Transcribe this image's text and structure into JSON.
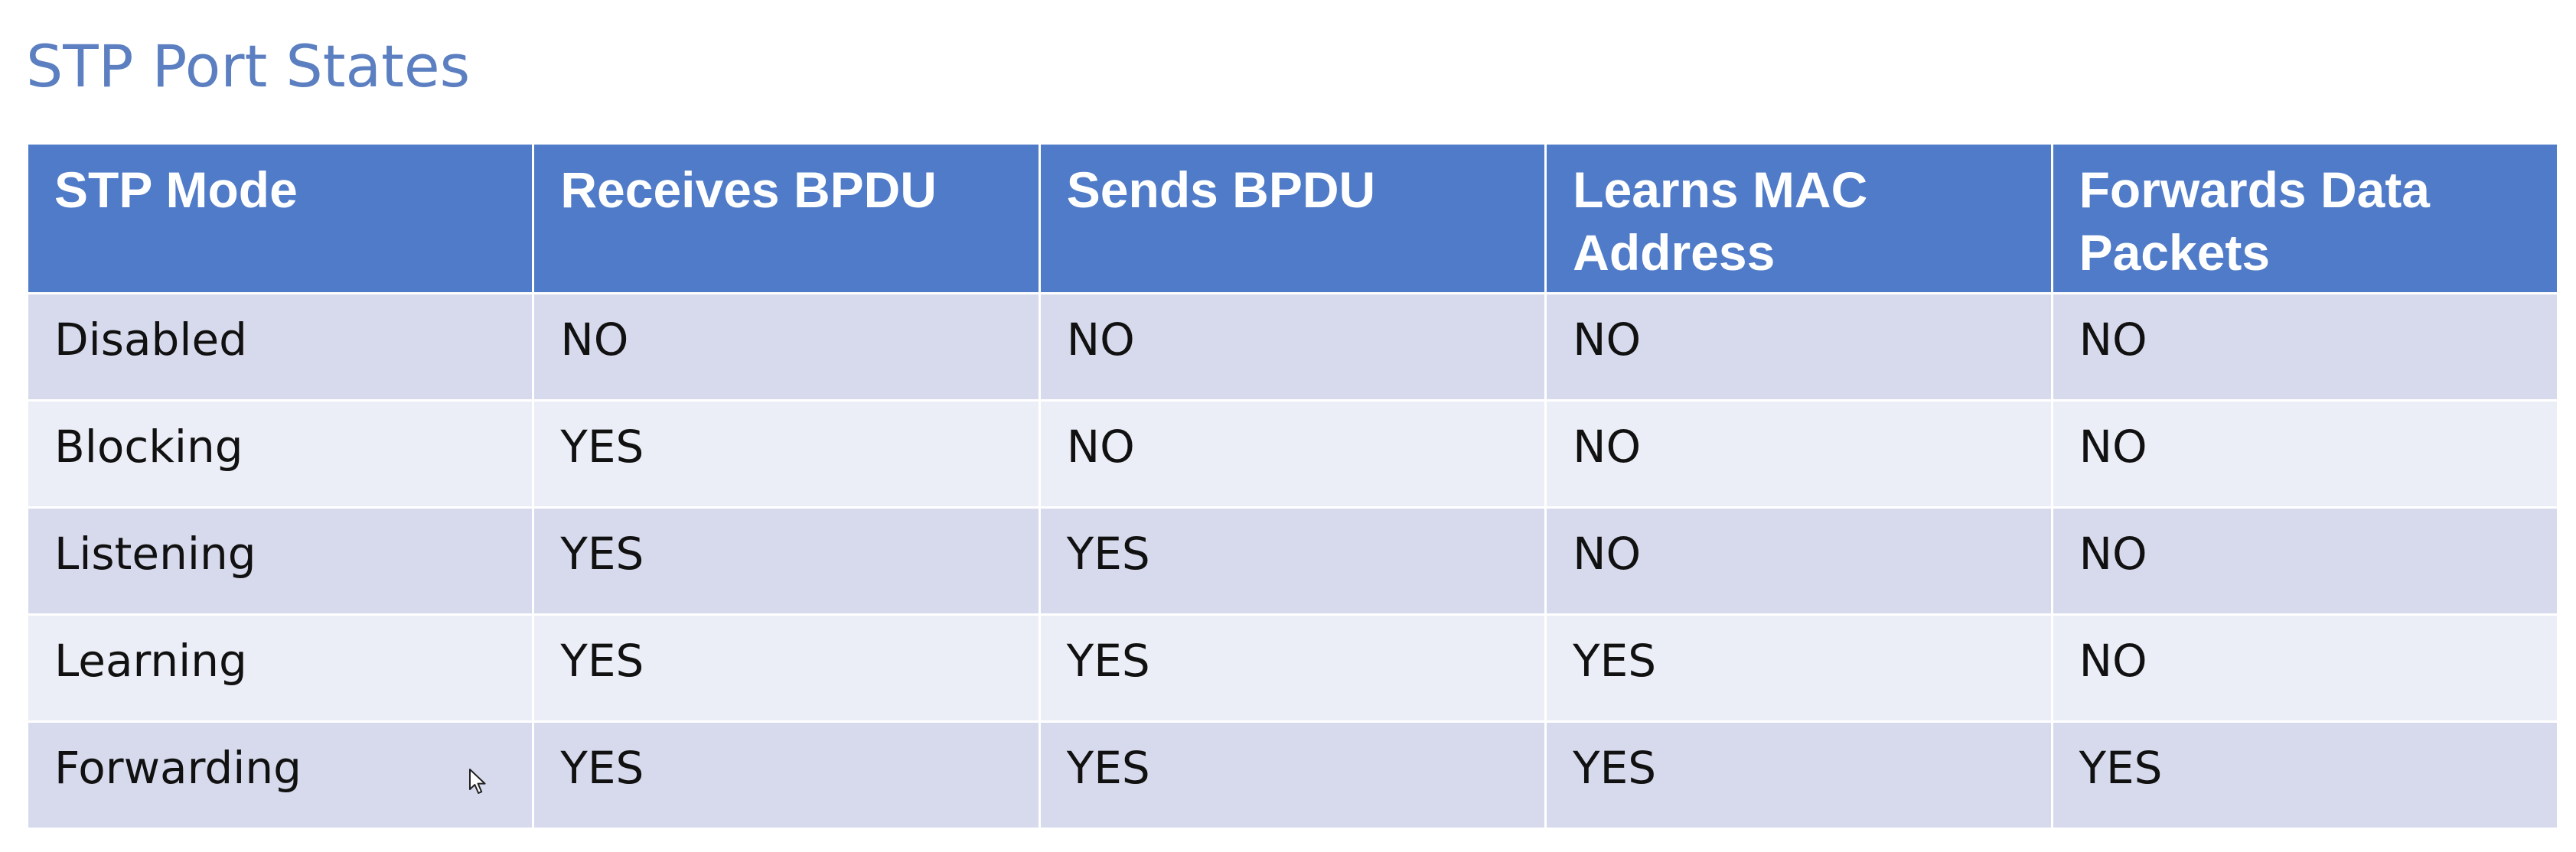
{
  "slide": {
    "title": "STP Port States"
  },
  "table": {
    "headers": [
      "STP Mode",
      "Receives BPDU",
      "Sends BPDU",
      "Learns MAC Address",
      "Forwards Data Packets"
    ],
    "rows": [
      [
        "Disabled",
        "NO",
        "NO",
        "NO",
        "NO"
      ],
      [
        "Blocking",
        "YES",
        "NO",
        "NO",
        "NO"
      ],
      [
        "Listening",
        "YES",
        "YES",
        "NO",
        "NO"
      ],
      [
        "Learning",
        "YES",
        "YES",
        "YES",
        "NO"
      ],
      [
        "Forwarding",
        "YES",
        "YES",
        "YES",
        "YES"
      ]
    ]
  },
  "colors": {
    "title": "#5b7fc0",
    "header_bg": "#4f7bc8",
    "row_band_dark": "#d6daec",
    "row_band_light": "#eceef7"
  },
  "icons": {
    "cursor": "mouse-pointer-icon"
  }
}
